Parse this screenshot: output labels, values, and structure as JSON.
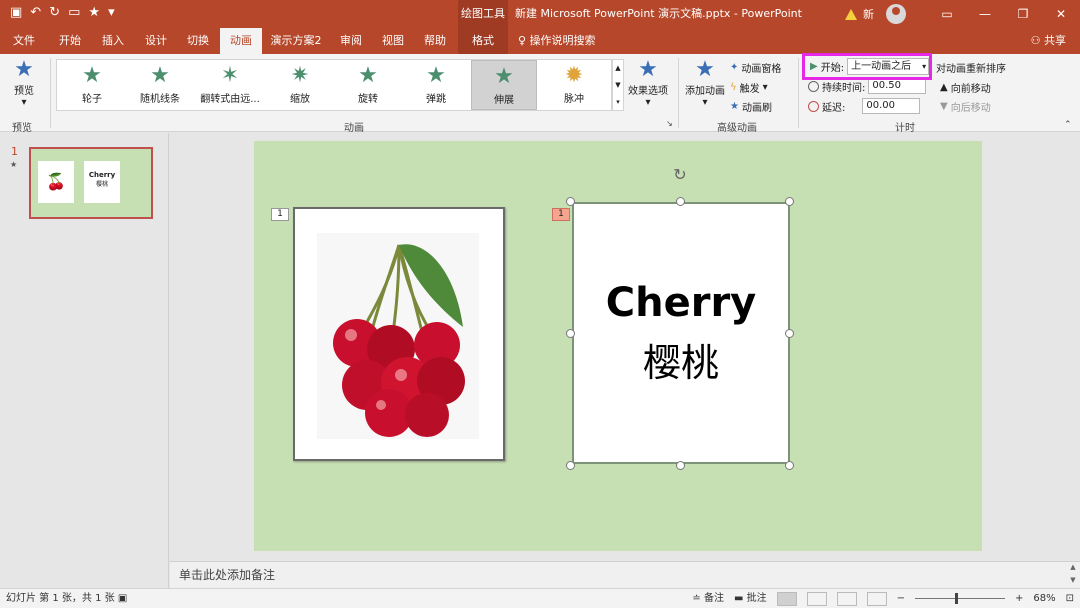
{
  "qat": {
    "save_icon": "save-icon",
    "undo_icon": "undo-icon",
    "redo_icon": "redo-icon"
  },
  "title": {
    "context_tools": "绘图工具",
    "document": "新建 Microsoft PowerPoint 演示文稿.pptx - PowerPoint",
    "user": "新"
  },
  "tabs": [
    "文件",
    "开始",
    "插入",
    "设计",
    "切换",
    "动画",
    "演示方案2",
    "审阅",
    "视图",
    "帮助",
    "格式"
  ],
  "active_tab": "动画",
  "tell_me": "操作说明搜索",
  "share": "共享",
  "ribbon": {
    "preview": {
      "label": "预览",
      "group": "预览"
    },
    "animations": {
      "items": [
        "轮子",
        "随机线条",
        "翻转式由远...",
        "缩放",
        "旋转",
        "弹跳",
        "伸展",
        "脉冲"
      ],
      "selected": "伸展",
      "effect_options": "效果选项",
      "group": "动画"
    },
    "advanced": {
      "add_animation": "添加动画",
      "animation_pane": "动画窗格",
      "trigger": "触发",
      "painter": "动画刷",
      "group": "高级动画"
    },
    "timing": {
      "start_label": "开始:",
      "start_value": "上一动画之后",
      "duration_label": "持续时间:",
      "duration_value": "00.50",
      "delay_label": "延迟:",
      "delay_value": "00.00",
      "reorder_title": "对动画重新排序",
      "move_earlier": "向前移动",
      "move_later": "向后移动",
      "group": "计时"
    }
  },
  "thumbnail": {
    "number": "1",
    "star": "★",
    "text_en": "Cherry",
    "text_zh": "樱桃"
  },
  "slide": {
    "tag_image": "1",
    "tag_text": "1",
    "text_en": "Cherry",
    "text_zh": "樱桃",
    "colors": {
      "slide_bg": "#c6e0b4",
      "accent": "#b7472a",
      "highlight": "#e629e6"
    }
  },
  "notes_placeholder": "单击此处添加备注",
  "status": {
    "slide_info": "幻灯片 第 1 张，共 1 张",
    "notes": "备注",
    "comments": "批注",
    "zoom": "68%"
  }
}
